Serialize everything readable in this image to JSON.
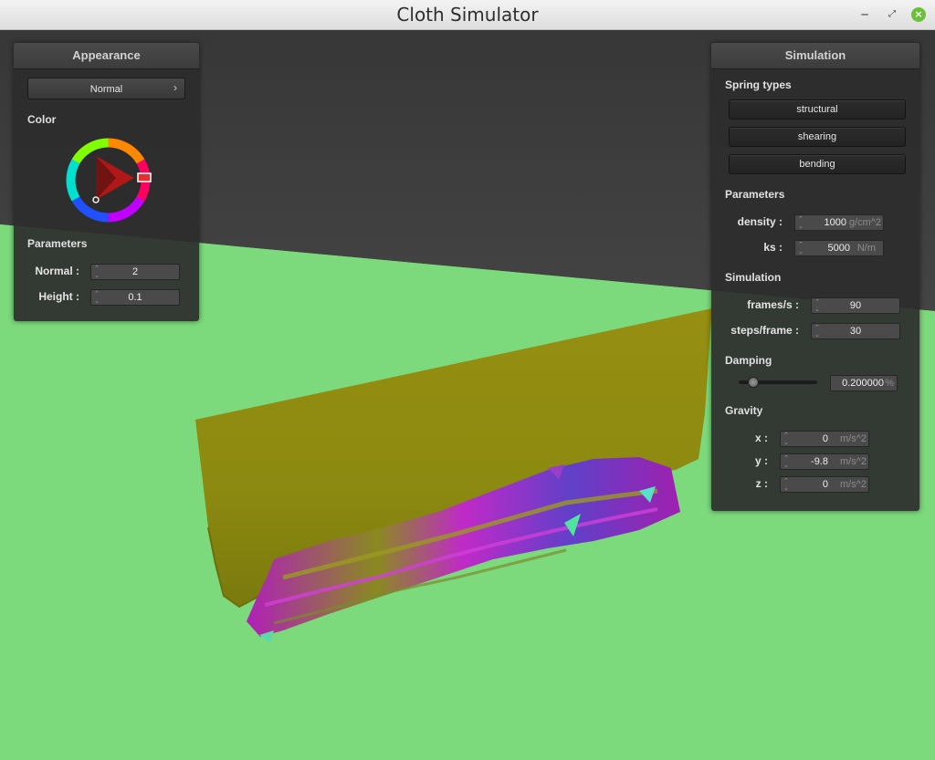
{
  "window": {
    "title": "Cloth Simulator"
  },
  "appearance": {
    "header": "Appearance",
    "shader_select": "Normal",
    "color_label": "Color",
    "parameters_label": "Parameters",
    "normal_label": "Normal :",
    "normal_value": "2",
    "height_label": "Height :",
    "height_value": "0.1"
  },
  "simulation": {
    "header": "Simulation",
    "spring_types_label": "Spring types",
    "structural_label": "structural",
    "shearing_label": "shearing",
    "bending_label": "bending",
    "parameters_label": "Parameters",
    "density_label": "density :",
    "density_value": "1000",
    "density_unit": "g/cm^2",
    "ks_label": "ks :",
    "ks_value": "5000",
    "ks_unit": "N/m",
    "simulation_label": "Simulation",
    "fps_label": "frames/s :",
    "fps_value": "90",
    "steps_label": "steps/frame :",
    "steps_value": "30",
    "damping_label": "Damping",
    "damping_slider_fraction": 0.2,
    "damping_value": "0.200000",
    "damping_unit": "%",
    "gravity_label": "Gravity",
    "gx_label": "x :",
    "gx_value": "0",
    "gy_label": "y :",
    "gy_value": "-9.8",
    "gz_label": "z :",
    "gz_value": "0",
    "gravity_unit": "m/s^2"
  },
  "colors": {
    "background_top": "#3a3a3a",
    "ground": "#7cd97c",
    "cloth": "#8f8d12"
  },
  "icons": {
    "close": "close-icon",
    "minimize": "minimize-icon",
    "maximize": "maximize-icon",
    "combo_arrow": "chevron-right-icon"
  }
}
